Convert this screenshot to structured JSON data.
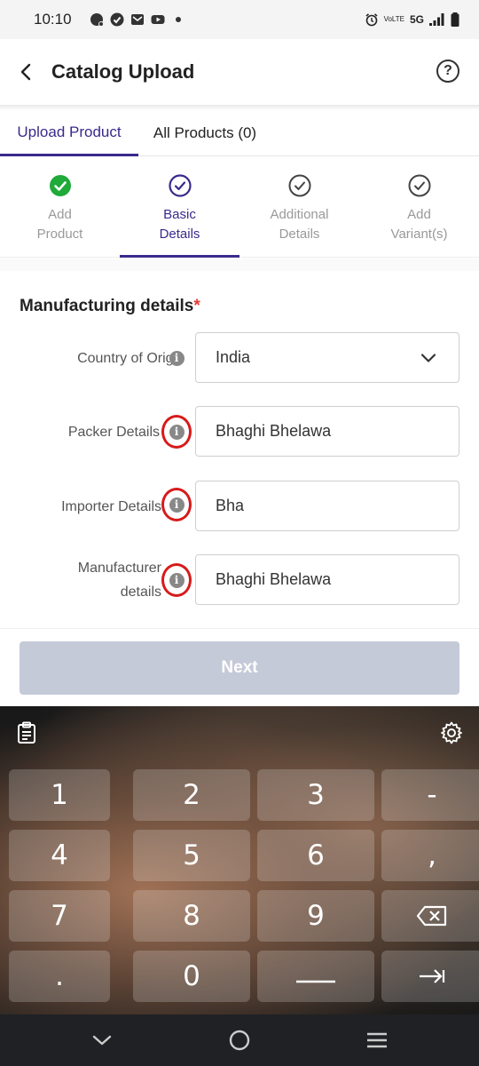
{
  "status_bar": {
    "time": "10:10",
    "network": "5G",
    "volte": "VoLTE"
  },
  "app_bar": {
    "title": "Catalog Upload",
    "help": "?"
  },
  "tabs": [
    {
      "label": "Upload Product",
      "active": true
    },
    {
      "label": "All Products (0)",
      "active": false
    }
  ],
  "stepper": [
    {
      "line1": "Add",
      "line2": "Product",
      "state": "done"
    },
    {
      "line1": "Basic",
      "line2": "Details",
      "state": "active"
    },
    {
      "line1": "Additional",
      "line2": "Details",
      "state": "pending"
    },
    {
      "line1": "Add",
      "line2": "Variant(s)",
      "state": "pending"
    }
  ],
  "form": {
    "section_title": "Manufacturing details",
    "required_mark": "*",
    "fields": [
      {
        "label": "Country of Origin",
        "value": "India",
        "type": "dropdown"
      },
      {
        "label": "Packer Details",
        "value": "Bhaghi Bhelawa",
        "type": "text"
      },
      {
        "label": "Importer Details",
        "value": "Bha",
        "type": "text"
      },
      {
        "label_line1": "Manufacturer",
        "label_line2": "details",
        "value": "Bhaghi Bhelawa",
        "type": "text"
      }
    ],
    "next_label": "Next"
  },
  "keyboard": {
    "rows": [
      [
        "1",
        "2",
        "3",
        "-"
      ],
      [
        "4",
        "5",
        "6",
        ","
      ],
      [
        "7",
        "8",
        "9",
        "⌫"
      ],
      [
        ".",
        "0",
        "space",
        "⇥"
      ]
    ]
  },
  "colors": {
    "accent": "#3a2a8c",
    "done_green": "#1faa3a",
    "highlight_red": "#d71a1a",
    "next_disabled": "#c5cad8"
  }
}
